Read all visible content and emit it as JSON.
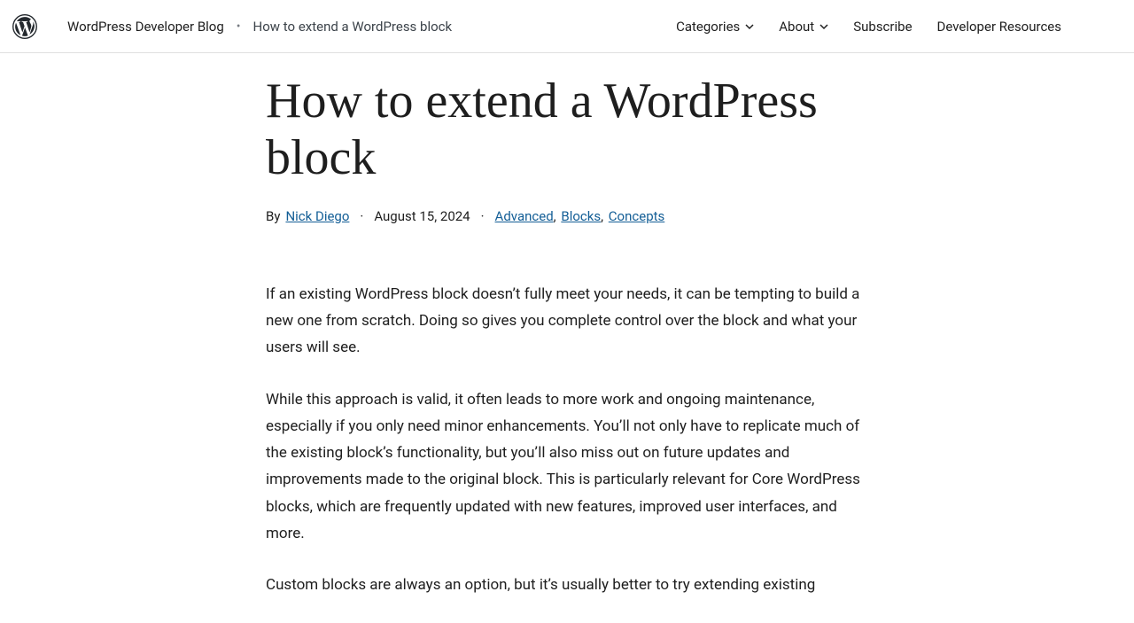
{
  "header": {
    "blog_name": "WordPress Developer Blog",
    "separator": "•",
    "current_page": "How to extend a WordPress block",
    "nav": {
      "categories": "Categories",
      "about": "About",
      "subscribe": "Subscribe",
      "resources": "Developer Resources"
    }
  },
  "article": {
    "title": "How to extend a WordPress block",
    "by_label": "By",
    "author": "Nick Diego",
    "dot": "·",
    "date": "August 15, 2024",
    "categories": [
      "Advanced",
      "Blocks",
      "Concepts"
    ],
    "p1": "If an existing WordPress block doesn’t fully meet your needs, it can be tempting to build a new one from scratch. Doing so gives you complete control over the block and what your users will see.",
    "p2": "While this approach is valid, it often leads to more work and ongoing maintenance, especially if you only need minor enhancements. You’ll not only have to replicate much of the existing block’s functionality, but you’ll also miss out on future updates and improvements made to the original block. This is particularly relevant for Core WordPress blocks, which are frequently updated with new features, improved user interfaces, and more.",
    "p3": "Custom blocks are always an option, but it’s usually better to try extending existing"
  }
}
